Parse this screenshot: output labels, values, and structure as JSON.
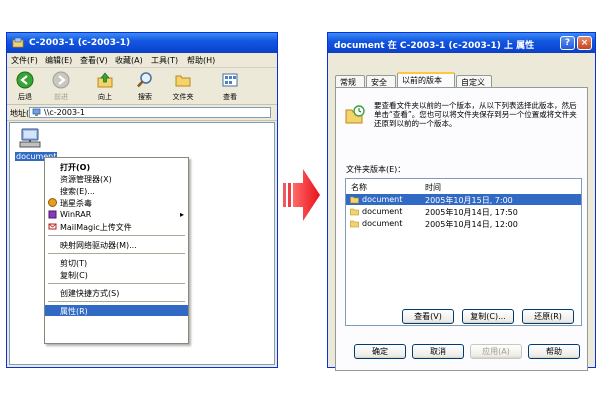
{
  "explorer": {
    "title": "C-2003-1 (c-2003-1)",
    "menu": [
      "文件(F)",
      "编辑(E)",
      "查看(V)",
      "收藏(A)",
      "工具(T)",
      "帮助(H)"
    ],
    "toolbar": {
      "back": "后退",
      "forward": "前进",
      "up": "向上",
      "search": "搜索",
      "folders": "文件夹",
      "views": "查看"
    },
    "address_label": "地址(D)",
    "address_value": "\\\\c-2003-1",
    "icon_label": "document",
    "context_menu": [
      {
        "label": "打开(O)",
        "bold": true
      },
      {
        "label": "资源管理器(X)"
      },
      {
        "label": "搜索(E)..."
      },
      {
        "label": "瑞星杀毒"
      },
      {
        "label": "WinRAR"
      },
      {
        "label": "MailMagic上传文件"
      },
      {
        "label": "映射网络驱动器(M)..."
      },
      {
        "label": "剪切(T)"
      },
      {
        "label": "复制(C)"
      },
      {
        "label": "创建快捷方式(S)"
      },
      {
        "label": "属性(R)"
      }
    ]
  },
  "dialog": {
    "title": "document 在 C-2003-1 (c-2003-1) 上 属性",
    "tabs": [
      "常规",
      "安全",
      "以前的版本",
      "自定义"
    ],
    "description": "要查看文件夹以前的一个版本，从以下列表选择此版本，然后单击“查看”。您也可以将文件夹保存到另一个位置或将文件夹还原到以前的一个版本。",
    "list_label": "文件夹版本(E)：",
    "col_name": "名称",
    "col_time": "时间",
    "versions": [
      {
        "name": "document",
        "time": "2005年10月15日, 7:00"
      },
      {
        "name": "document",
        "time": "2005年10月14日, 17:50"
      },
      {
        "name": "document",
        "time": "2005年10月14日, 12:00"
      }
    ],
    "view_button": "查看(V)",
    "copy_button": "复制(C)...",
    "restore_button": "还原(R)",
    "ok_button": "确定",
    "cancel_button": "取消",
    "apply_button": "应用(A)",
    "help_button": "帮助"
  },
  "colors": {
    "titlebar": "#0a46d4",
    "selection": "#316ac5",
    "arrow": "#e8101a"
  }
}
